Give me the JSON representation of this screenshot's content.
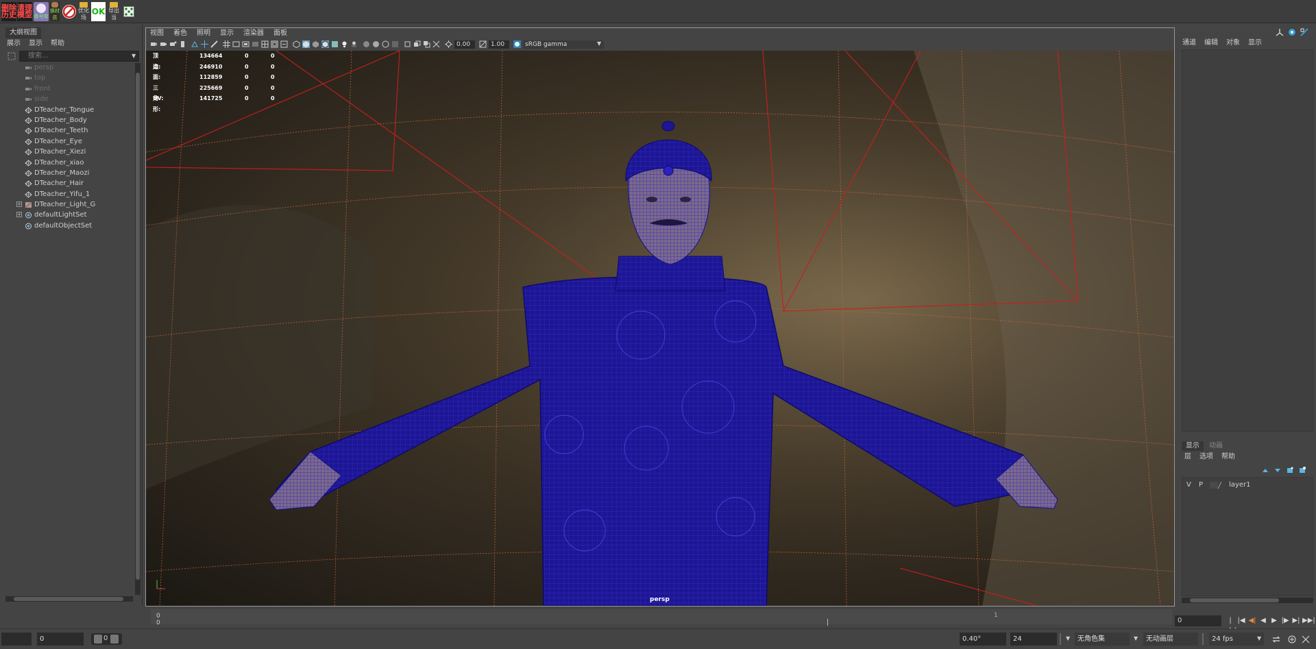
{
  "shelf": {
    "buttons": [
      {
        "name": "delete-history-button",
        "lines": [
          "删除",
          "历史"
        ]
      },
      {
        "name": "clean-model-button",
        "lines": [
          "清理",
          "模型"
        ]
      },
      {
        "name": "anime-tool-button",
        "label": "番号库"
      },
      {
        "name": "character-tool-button",
        "label": "换材质"
      },
      {
        "name": "no-entry-button",
        "label": ""
      },
      {
        "name": "optimize-scene-button",
        "label": "优化场"
      },
      {
        "name": "ok-button",
        "label": "OK"
      },
      {
        "name": "export-button",
        "label": "导出当"
      },
      {
        "name": "dice-button",
        "label": ""
      }
    ]
  },
  "outliner": {
    "tab": "大纲视图",
    "menus": [
      "展示",
      "显示",
      "帮助"
    ],
    "search_placeholder": "搜索...",
    "items": [
      {
        "label": "persp",
        "type": "camera",
        "dim": true,
        "expand": false
      },
      {
        "label": "top",
        "type": "camera",
        "dim": true,
        "expand": false
      },
      {
        "label": "front",
        "type": "camera",
        "dim": true,
        "expand": false
      },
      {
        "label": "side",
        "type": "camera",
        "dim": true,
        "expand": false
      },
      {
        "label": "DTeacher_Tongue",
        "type": "mesh",
        "dim": false,
        "expand": false
      },
      {
        "label": "DTeacher_Body",
        "type": "mesh",
        "dim": false,
        "expand": false
      },
      {
        "label": "DTeacher_Teeth",
        "type": "mesh",
        "dim": false,
        "expand": false
      },
      {
        "label": "DTeacher_Eye",
        "type": "mesh",
        "dim": false,
        "expand": false
      },
      {
        "label": "DTeacher_Xiezi",
        "type": "mesh",
        "dim": false,
        "expand": false
      },
      {
        "label": "DTeacher_xiao",
        "type": "mesh",
        "dim": false,
        "expand": false
      },
      {
        "label": "DTeacher_Maozi",
        "type": "mesh",
        "dim": false,
        "expand": false
      },
      {
        "label": "DTeacher_Hair",
        "type": "mesh",
        "dim": false,
        "expand": false
      },
      {
        "label": "DTeacher_Yifu_1",
        "type": "mesh",
        "dim": false,
        "expand": false
      },
      {
        "label": "DTeacher_Light_G",
        "type": "light",
        "dim": false,
        "expand": true
      },
      {
        "label": "defaultLightSet",
        "type": "set",
        "dim": false,
        "expand": true
      },
      {
        "label": "defaultObjectSet",
        "type": "set",
        "dim": false,
        "expand": false
      }
    ]
  },
  "viewport": {
    "menus": [
      "视图",
      "着色",
      "照明",
      "显示",
      "渲染器",
      "面板"
    ],
    "exposure": "0.00",
    "gamma": "1.00",
    "color_space": "sRGB gamma",
    "camera": "persp",
    "hud": [
      {
        "label": "顶点:",
        "v1": "134664",
        "v2": "0",
        "v3": "0"
      },
      {
        "label": "边:",
        "v1": "246910",
        "v2": "0",
        "v3": "0"
      },
      {
        "label": "面:",
        "v1": "112859",
        "v2": "0",
        "v3": "0"
      },
      {
        "label": "三角形:",
        "v1": "225669",
        "v2": "0",
        "v3": "0"
      },
      {
        "label": "UV:",
        "v1": "141725",
        "v2": "0",
        "v3": "0"
      }
    ]
  },
  "channel_box": {
    "menus": [
      "通道",
      "编辑",
      "对象",
      "显示"
    ]
  },
  "layers": {
    "tabs": [
      "显示",
      "动画"
    ],
    "menus": [
      "层",
      "选项",
      "帮助"
    ],
    "rows": [
      {
        "v": "V",
        "p": "P",
        "name": "layer1"
      }
    ]
  },
  "time_slider": {
    "playhead": "0",
    "start_tick": "0",
    "mid_tick": "1",
    "current_frame": "0"
  },
  "range_bar": {
    "start_field": "",
    "anim_start": "0",
    "range_start": "0",
    "angle": "0.40°",
    "anim_end": "24",
    "character_set": "无角色集",
    "anim_layer": "无动画层",
    "fps": "24 fps"
  },
  "colors": {
    "wireframe": "#1a10b8",
    "wire_line": "#2b1fff",
    "camera_frustum": "#c81e1e",
    "grid": "#c76b3a"
  }
}
